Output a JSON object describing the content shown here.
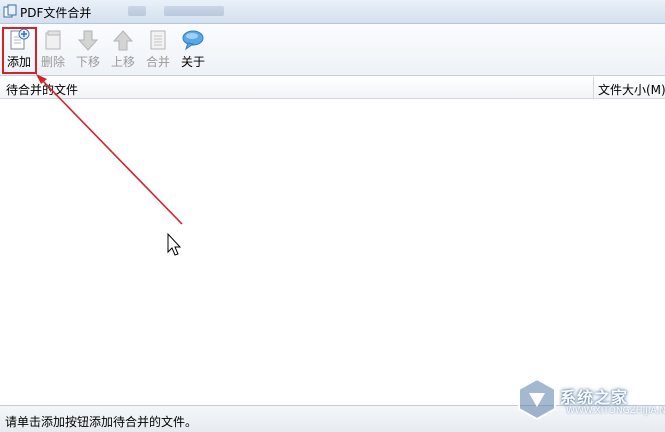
{
  "window": {
    "title": "PDF文件合并"
  },
  "toolbar": {
    "buttons": [
      {
        "id": "add",
        "label": "添加",
        "icon": "add-document-icon",
        "enabled": true
      },
      {
        "id": "delete",
        "label": "删除",
        "icon": "delete-document-icon",
        "enabled": false
      },
      {
        "id": "move_down",
        "label": "下移",
        "icon": "arrow-down-icon",
        "enabled": false
      },
      {
        "id": "move_up",
        "label": "上移",
        "icon": "arrow-up-icon",
        "enabled": false
      },
      {
        "id": "merge",
        "label": "合并",
        "icon": "merge-document-icon",
        "enabled": false
      },
      {
        "id": "about",
        "label": "关于",
        "icon": "speech-bubble-icon",
        "enabled": true
      }
    ]
  },
  "list": {
    "columns": [
      "待合并的文件",
      "文件大小(M)"
    ],
    "rows": []
  },
  "statusbar": {
    "text": "请单击添加按钮添加待合并的文件。"
  },
  "watermark": {
    "text": "系统之家",
    "url": "WWW.XITONGZHIJIA.NET"
  },
  "colors": {
    "annotation": "#d2232a",
    "titlebar": "#d4e0ee",
    "disabled_text": "#9a9a9a"
  }
}
